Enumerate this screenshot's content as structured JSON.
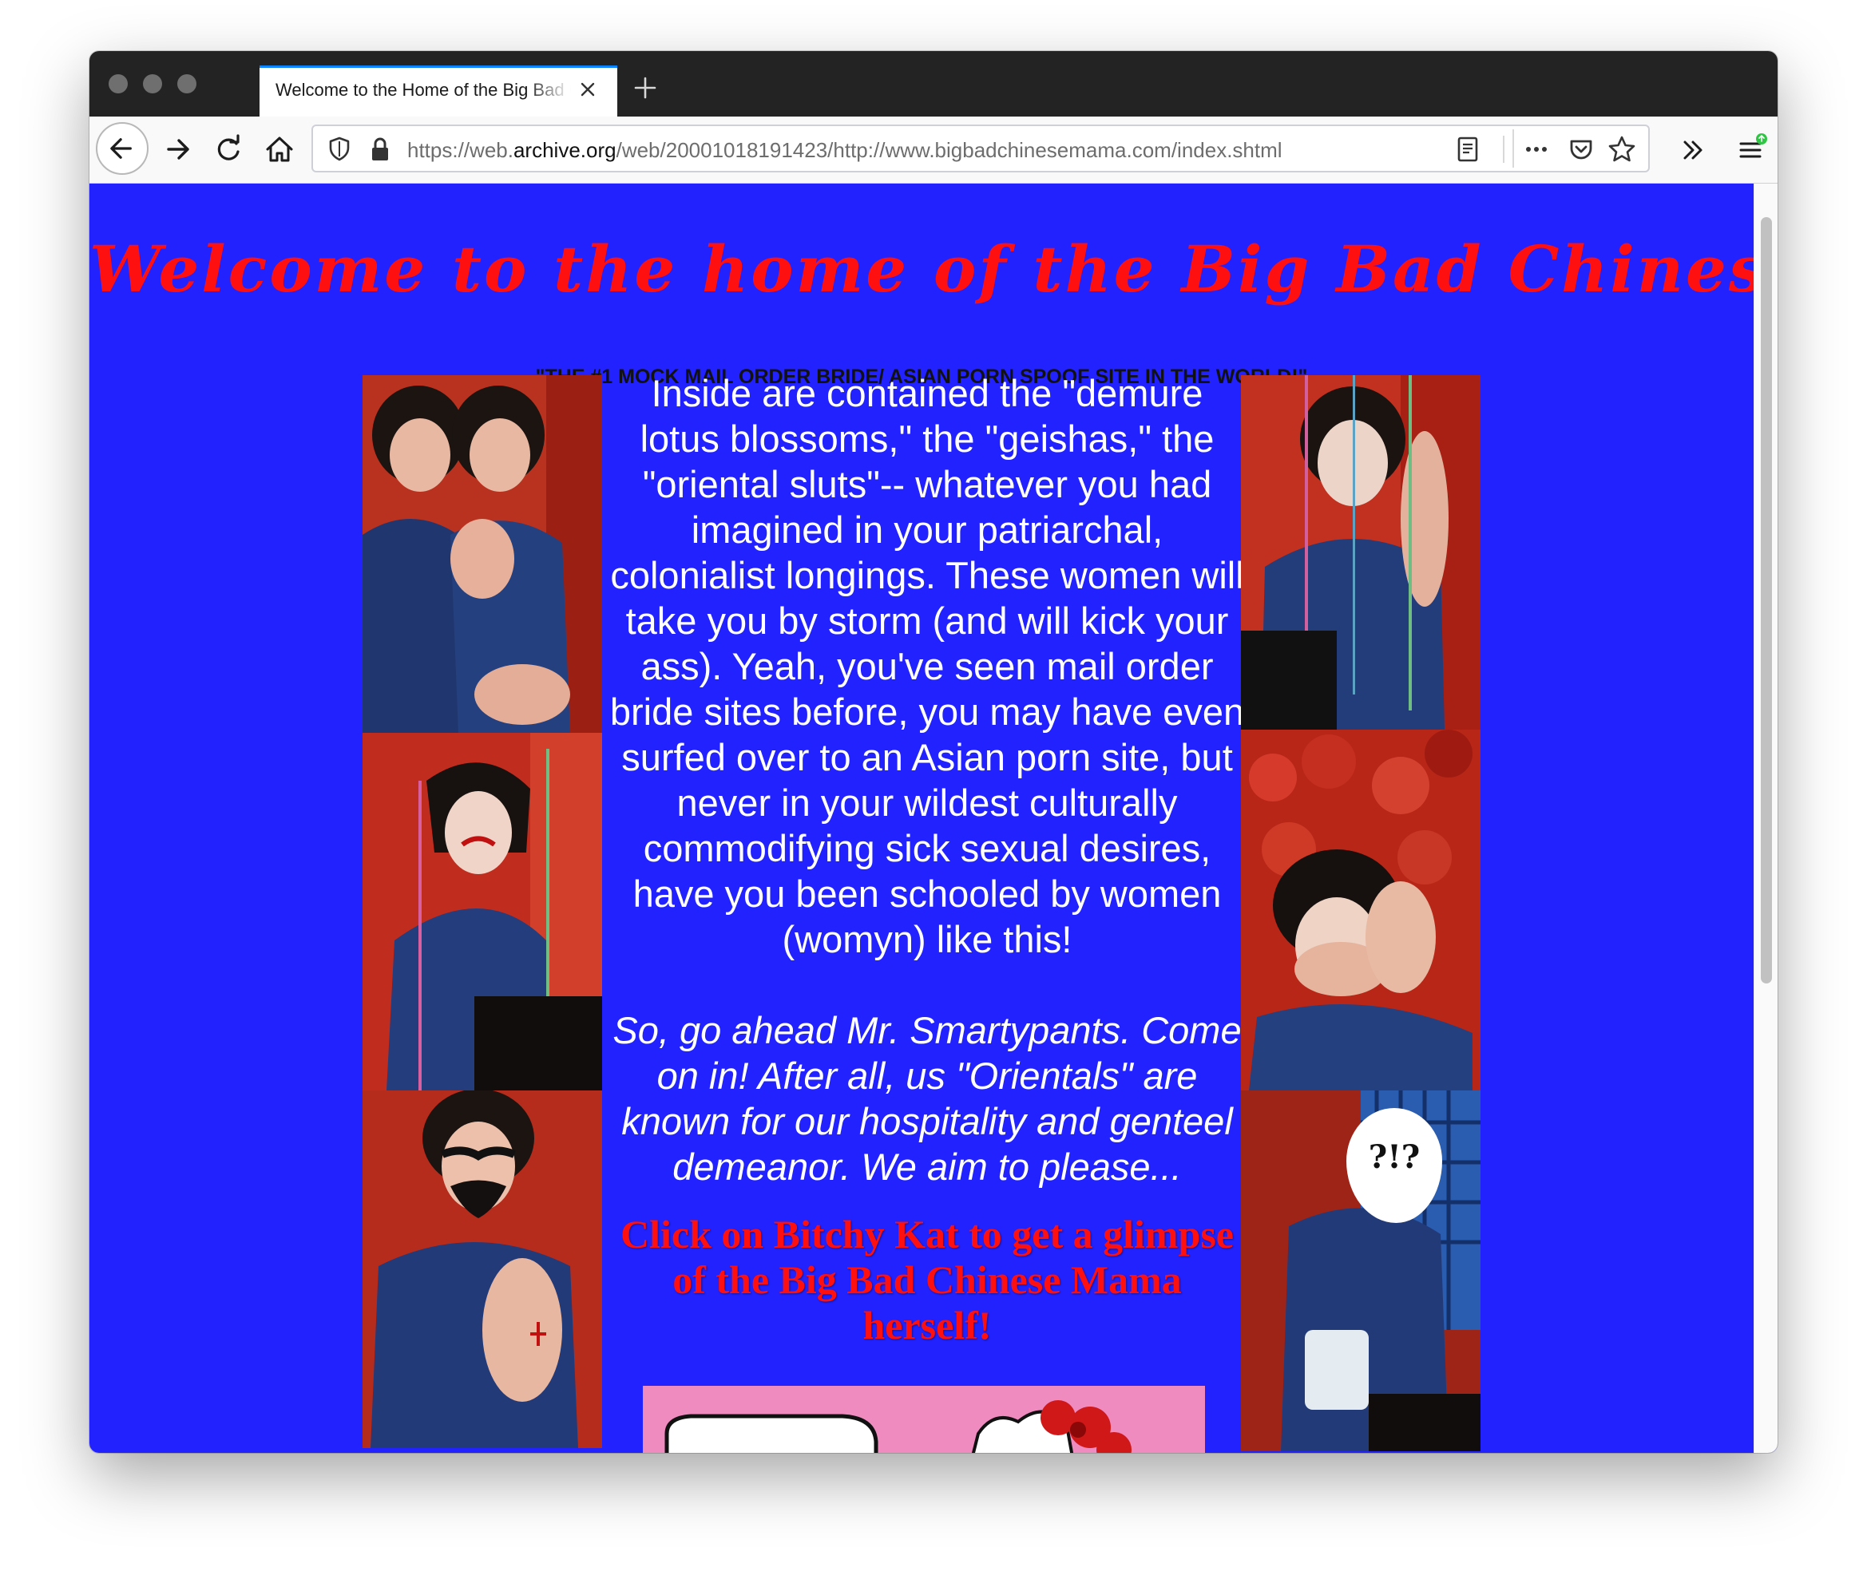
{
  "browser": {
    "tab_title": "Welcome to the Home of the Big Bad Chinese Mama!",
    "url_prefix": "https://web.",
    "url_host": "archive.org",
    "url_path": "/web/20001018191423/http://www.bigbadchinesemama.com/index.shtml"
  },
  "page": {
    "headline": "Welcome to the home of the Big Bad Chinese Mama!",
    "subheadline": "\"THE #1 MOCK MAIL ORDER BRIDE/ ASIAN PORN SPOOF SITE IN THE WORLD!\"",
    "intro": "Inside are contained the \"demure lotus blossoms,\" the \"geishas,\" the \"oriental sluts\"-- whatever you had imagined in your patriarchal, colonialist longings. These women will take you by storm (and will kick your ass). Yeah, you've seen mail order bride sites before, you may have even surfed over to an Asian porn site, but never in your wildest culturally commodifying sick sexual desires, have you been schooled by women (womyn) like this!",
    "invite": "So, go ahead Mr. Smartypants. Come on in! After all, us \"Orientals\" are known for our hospitality and genteel demeanor. We aim to please...",
    "cta": "Click on Bitchy Kat to get a glimpse of the Big Bad Chinese Mama herself!",
    "photo_caption": "?!?"
  },
  "colors": {
    "page_background": "#2222ff",
    "headline": "#ff1010",
    "body_text": "#ffffff",
    "tab_accent": "#0a84ff"
  }
}
